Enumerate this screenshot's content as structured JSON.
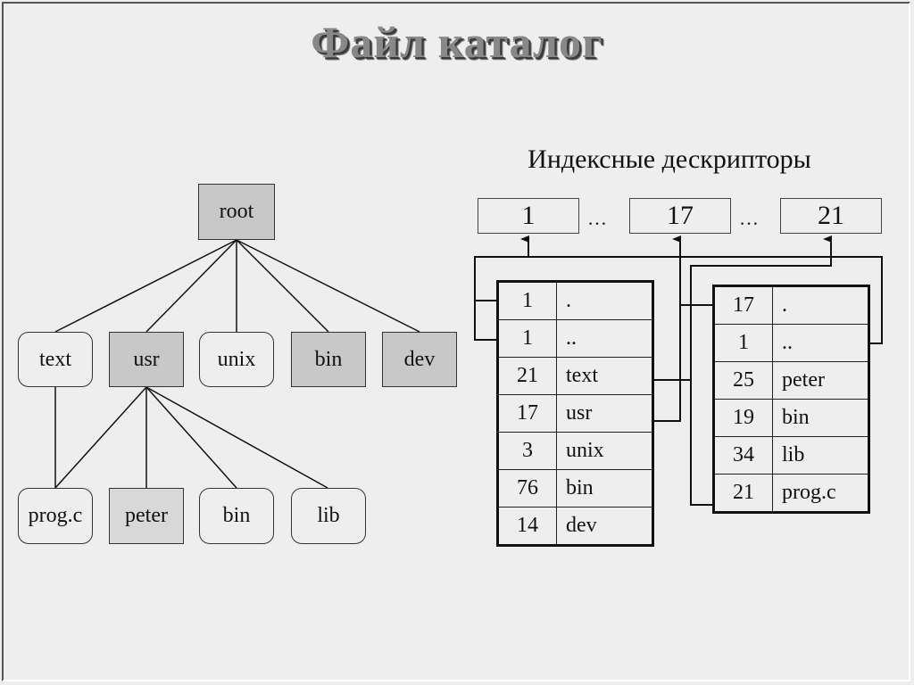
{
  "title": "Файл каталог",
  "subtitle": "Индексные дескрипторы",
  "colors": {
    "background": "#eeeeee",
    "directory_fill": "#c8c8c8",
    "file_fill": "#eeeeee",
    "line": "#111111"
  },
  "tree": {
    "root": {
      "label": "root",
      "type": "directory"
    },
    "level1": [
      {
        "label": "text",
        "type": "file"
      },
      {
        "label": "usr",
        "type": "directory"
      },
      {
        "label": "unix",
        "type": "file"
      },
      {
        "label": "bin",
        "type": "directory"
      },
      {
        "label": "dev",
        "type": "directory"
      }
    ],
    "level2": [
      {
        "label": "prog.c",
        "type": "file",
        "parent": "text"
      },
      {
        "label": "peter",
        "type": "directory",
        "parent": "usr"
      },
      {
        "label": "bin",
        "type": "file",
        "parent": "usr"
      },
      {
        "label": "lib",
        "type": "file",
        "parent": "usr"
      }
    ]
  },
  "inodes": {
    "items": [
      "1",
      "17",
      "21"
    ],
    "ellipsis": "…"
  },
  "root_directory_table": {
    "rows": [
      {
        "inode": "1",
        "name": "."
      },
      {
        "inode": "1",
        "name": ".."
      },
      {
        "inode": "21",
        "name": "text"
      },
      {
        "inode": "17",
        "name": "usr"
      },
      {
        "inode": "3",
        "name": "unix"
      },
      {
        "inode": "76",
        "name": "bin"
      },
      {
        "inode": "14",
        "name": "dev"
      }
    ]
  },
  "usr_directory_table": {
    "rows": [
      {
        "inode": "17",
        "name": "."
      },
      {
        "inode": "1",
        "name": ".."
      },
      {
        "inode": "25",
        "name": "peter"
      },
      {
        "inode": "19",
        "name": "bin"
      },
      {
        "inode": "34",
        "name": "lib"
      },
      {
        "inode": "21",
        "name": "prog.c"
      }
    ]
  }
}
